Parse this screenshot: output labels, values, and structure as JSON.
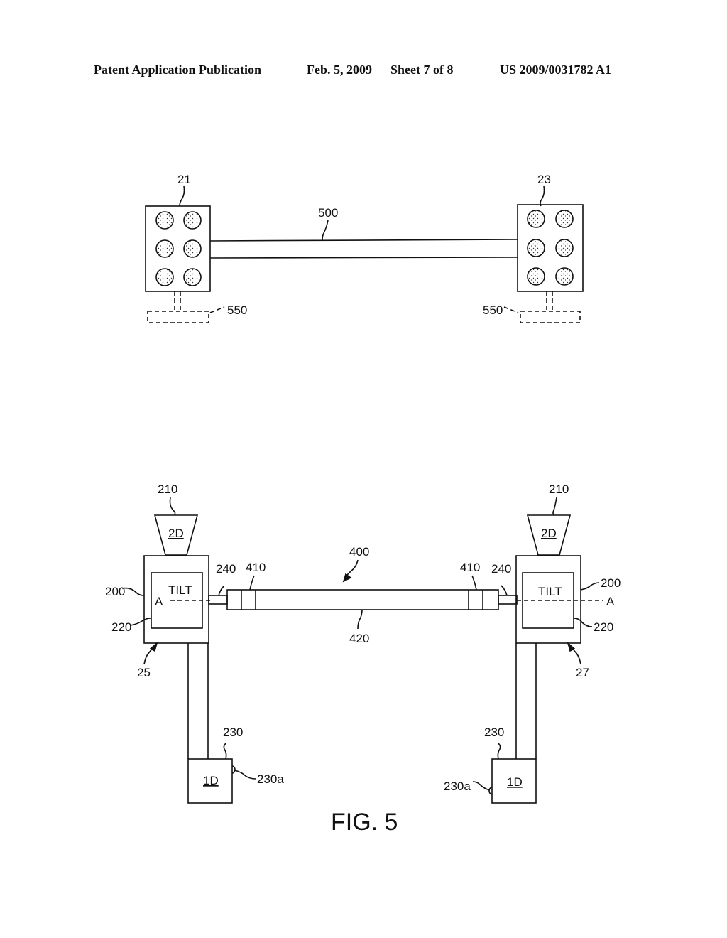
{
  "header": {
    "left": "Patent Application Publication",
    "date": "Feb. 5, 2009",
    "sheet": "Sheet 7 of 8",
    "number": "US 2009/0031782 A1"
  },
  "top_diagram": {
    "left_unit": "21",
    "right_unit": "23",
    "connector": "500",
    "base_left": "550",
    "base_right": "550"
  },
  "bottom_diagram": {
    "camera_label": "210",
    "camera_text": "2D",
    "housing_label": "200",
    "tilt_label": "220",
    "tilt_text": "TILT",
    "axis_label": "A",
    "shaft_label": "240",
    "coupler_label": "410",
    "assembly_label": "400",
    "bar_label": "420",
    "left_post": "25",
    "right_post": "27",
    "sensor_label": "230",
    "sensor_text": "1D",
    "sensor_button_label": "230a"
  },
  "figure_title": "FIG. 5"
}
